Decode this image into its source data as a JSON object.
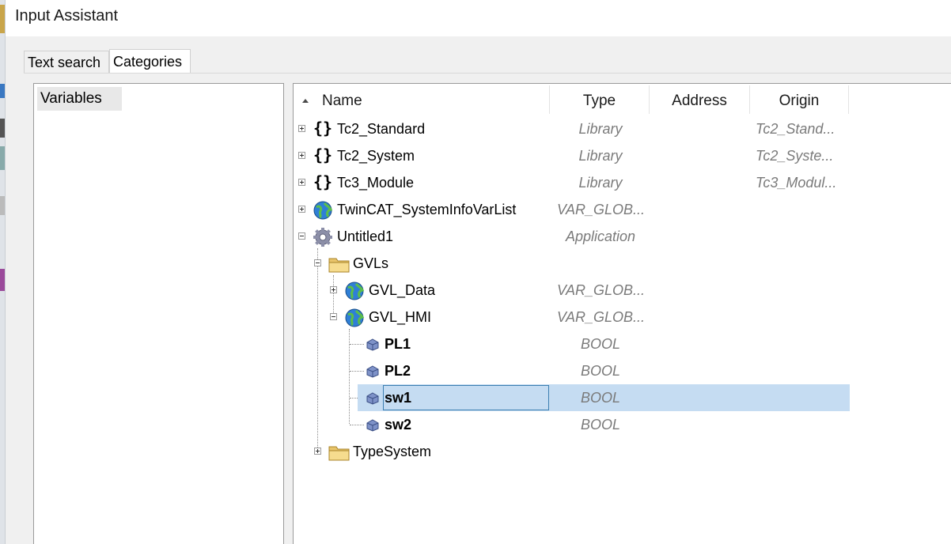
{
  "window": {
    "title": "Input Assistant"
  },
  "tabs": [
    {
      "label": "Text search",
      "active": false
    },
    {
      "label": "Categories",
      "active": true
    }
  ],
  "categories": {
    "selected": "Variables"
  },
  "columns": {
    "name": "Name",
    "type": "Type",
    "address": "Address",
    "origin": "Origin"
  },
  "tree": {
    "tc2_standard": {
      "name": "Tc2_Standard",
      "type": "Library",
      "origin": "Tc2_Stand..."
    },
    "tc2_system": {
      "name": "Tc2_System",
      "type": "Library",
      "origin": "Tc2_Syste..."
    },
    "tc3_module": {
      "name": "Tc3_Module",
      "type": "Library",
      "origin": "Tc3_Modul..."
    },
    "twincat_sys": {
      "name": "TwinCAT_SystemInfoVarList",
      "type": "VAR_GLOB..."
    },
    "untitled1": {
      "name": "Untitled1",
      "type": "Application"
    },
    "gvls": {
      "name": "GVLs"
    },
    "gvl_data": {
      "name": "GVL_Data",
      "type": "VAR_GLOB..."
    },
    "gvl_hmi": {
      "name": "GVL_HMI",
      "type": "VAR_GLOB..."
    },
    "pl1": {
      "name": "PL1",
      "type": "BOOL"
    },
    "pl2": {
      "name": "PL2",
      "type": "BOOL"
    },
    "sw1": {
      "name": "sw1",
      "type": "BOOL",
      "selected": true
    },
    "sw2": {
      "name": "sw2",
      "type": "BOOL"
    },
    "typesystem": {
      "name": "TypeSystem"
    }
  },
  "colors": {
    "selection": "#c5dcf2",
    "selection_border": "#3c7fb1",
    "italic_text": "#7a7a7a"
  }
}
